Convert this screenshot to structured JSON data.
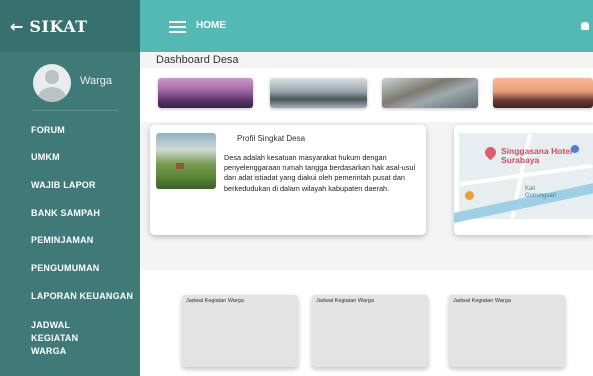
{
  "app": {
    "back_icon": "arrow-left-icon",
    "title": "SIKAT"
  },
  "user": {
    "name": "Warga",
    "avatar_icon": "user-avatar-icon"
  },
  "sidebar": {
    "items": [
      {
        "label": "FORUM"
      },
      {
        "label": "UMKM"
      },
      {
        "label": "WAJIB LAPOR"
      },
      {
        "label": "BANK SAMPAH"
      },
      {
        "label": "PEMINJAMAN"
      },
      {
        "label": "PENGUMUMAN"
      },
      {
        "label": "LAPORAN KEUANGAN"
      },
      {
        "label": "JADWAL KEGIATAN WARGA"
      }
    ]
  },
  "topbar": {
    "menu_icon": "hamburger-icon",
    "home_label": "HOME",
    "notif_icon": "bell-icon"
  },
  "dashboard": {
    "title": "Dashboard Desa"
  },
  "profile": {
    "title": "Profil Singkat Desa",
    "text": "Desa adalah kesatuan masyarakat hukum dengan penyelenggaraan rumah tangga berdasarkan hak asal-usul dan adat istiadat yang diakui oleh pemerintah pusat dan berkedudukan di dalam wilayah kabupaten daerah."
  },
  "map": {
    "place": "Singgasana Hotel Surabaya",
    "river": "Kali Gunungsari"
  },
  "schedule": {
    "cards": [
      {
        "title": "Jadwal Kegiatan Warga"
      },
      {
        "title": "Jadwal Kegiatan Warga"
      },
      {
        "title": "Jadwal Kegiatan Warga"
      }
    ]
  },
  "colors": {
    "sidebar": "#3f7a78",
    "brand": "#37716f",
    "topbar": "#54b9b5",
    "content_bg": "#f4f4f4"
  }
}
